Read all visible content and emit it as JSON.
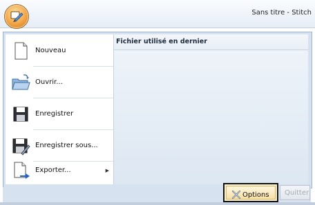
{
  "window": {
    "title": "Sans titre - Stitch"
  },
  "commands": [
    {
      "label": "Nouveau",
      "icon": "new-document-icon"
    },
    {
      "label": "Ouvrir...",
      "icon": "open-folder-icon"
    },
    {
      "label": "Enregistrer",
      "icon": "save-icon"
    },
    {
      "label": "Enregistrer sous...",
      "icon": "save-as-icon"
    },
    {
      "label": "Exporter...",
      "icon": "export-icon",
      "submenu_arrow": "▶"
    }
  ],
  "recent": {
    "header": "Fichier utilisé en dernier",
    "items": []
  },
  "footer": {
    "options_label": "Options",
    "quit_label": "Quitter",
    "options_icon": "options-icon"
  },
  "colors": {
    "accent": "#f2a445",
    "menu_frame": "#d6e2f0",
    "highlight": "#111111"
  }
}
